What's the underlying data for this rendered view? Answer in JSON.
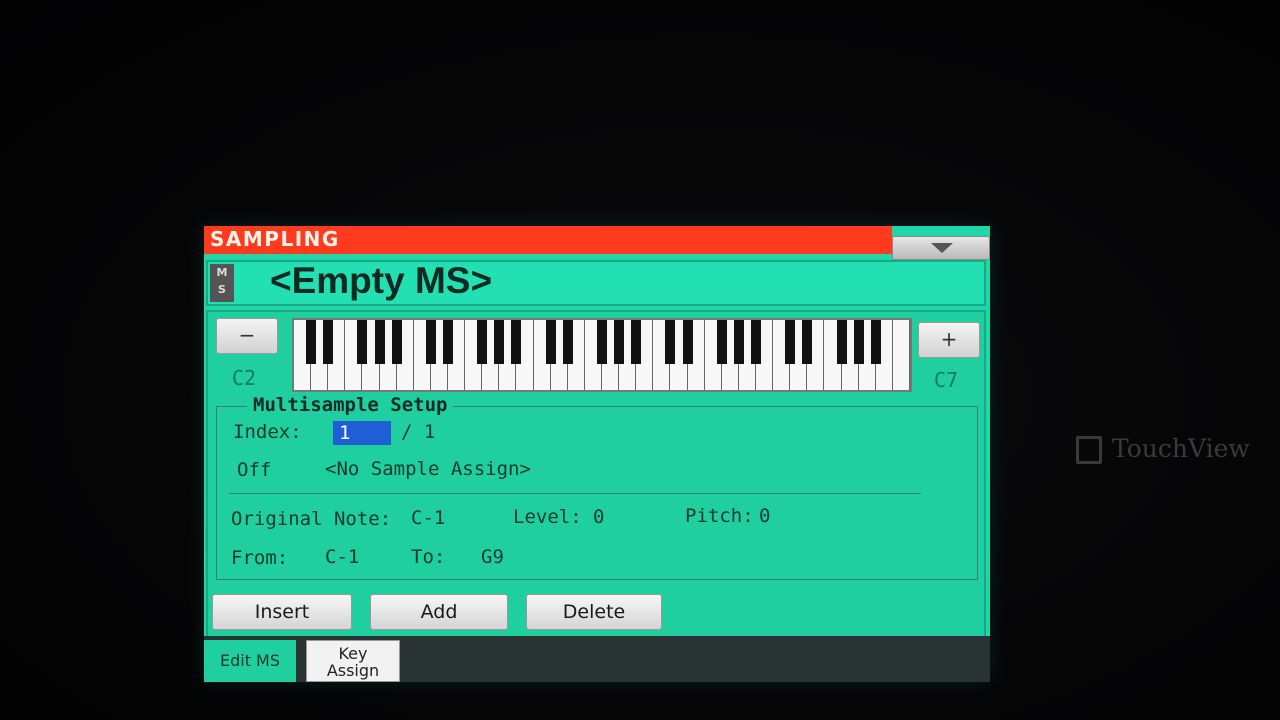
{
  "window": {
    "title": "SAMPLING"
  },
  "header": {
    "badge": "MS",
    "name": "<Empty MS>"
  },
  "keyboard": {
    "minus_label": "−",
    "plus_label": "+",
    "low_note": "C2",
    "high_note": "C7",
    "octaves": 5
  },
  "setup": {
    "title": "Multisample Setup",
    "index_label": "Index:",
    "index_value": "1",
    "index_total": "/ 1",
    "off_label": "Off",
    "sample_assign": "<No Sample Assign>",
    "original_note_label": "Original Note:",
    "original_note_value": "C-1",
    "level_label": "Level:",
    "level_value": "0",
    "pitch_label": "Pitch:",
    "pitch_value": "0",
    "from_label": "From:",
    "from_value": "C-1",
    "to_label": "To:",
    "to_value": "G9"
  },
  "buttons": {
    "insert": "Insert",
    "add": "Add",
    "delete": "Delete"
  },
  "tabs": [
    {
      "line1": "Edit MS",
      "line2": ""
    },
    {
      "line1": "Key",
      "line2": "Assign"
    }
  ],
  "watermark": {
    "text": "TouchView",
    "icon": "touchview-logo-icon"
  },
  "colors": {
    "title_bar": "#ff3b1f",
    "panel": "#1fcf9f",
    "index_highlight": "#1f5ed6"
  }
}
